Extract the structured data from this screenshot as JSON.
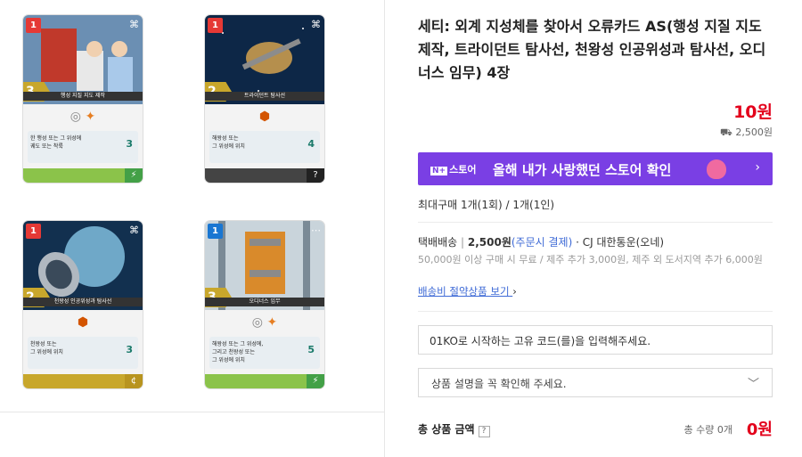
{
  "cards": [
    {
      "cost": "1",
      "corner": "⌘",
      "name": "행성 지질 지도 제작",
      "points": "3",
      "mission": "한 행성 또는 그 위성에\n궤도 또는 착륙",
      "score": "3",
      "theme": "lab"
    },
    {
      "cost": "1",
      "corner": "⌘",
      "name": "트라이던트 탐사선",
      "points": "2",
      "mission": "해왕성 또는\n그 위성에 위치",
      "score": "4",
      "theme": "space"
    },
    {
      "cost": "1",
      "corner": "⌘",
      "name": "천왕성 인공위성과 탐사선",
      "points": "2",
      "mission": "천왕성 또는\n그 위성에 위치",
      "score": "3",
      "theme": "planet"
    },
    {
      "cost": "1",
      "corner": "⋯",
      "name": "오디너스 임무",
      "points": "3",
      "mission": "해왕성 또는 그 위성에,\n그리고 천왕성 또는\n그 위성에 위치",
      "score": "5",
      "theme": "rocket"
    }
  ],
  "product": {
    "title": "세티: 외계 지성체를 찾아서 오류카드 AS(행성 지질 지도 제작, 트라이던트 탐사선, 천왕성 인공위성과 탐사선, 오디너스 임무) 4장",
    "price": "10원",
    "shipping_fee": "2,500원"
  },
  "banner": {
    "logo_mark": "N+",
    "logo_text": "스토어",
    "text": "올해 내가 사랑했던 스토어 확인",
    "bg_color": "#7a3fe4"
  },
  "max_buy": "최대구매 1개(1회) / 1개(1인)",
  "shipping": {
    "type": "택배배송",
    "fee": "2,500원",
    "payment": "(주문시 결제)",
    "carrier": "· CJ 대한통운(오네)",
    "note": "50,000원 이상 구매 시 무료 / 제주 추가 3,000원, 제주 외 도서지역 추가 6,000원",
    "save_link": "배송비 절약상품 보기"
  },
  "code_input": {
    "placeholder": "01KO로 시작하는 고유 코드(를)을 입력해주세요."
  },
  "select": {
    "value": "상품 설명을 꼭 확인해 주세요."
  },
  "total": {
    "label": "총 상품 금액",
    "help": "?",
    "qty": "총 수량 0개",
    "price": "0원"
  },
  "colors": {
    "price": "#e3001b",
    "link": "#3e6ad6"
  }
}
